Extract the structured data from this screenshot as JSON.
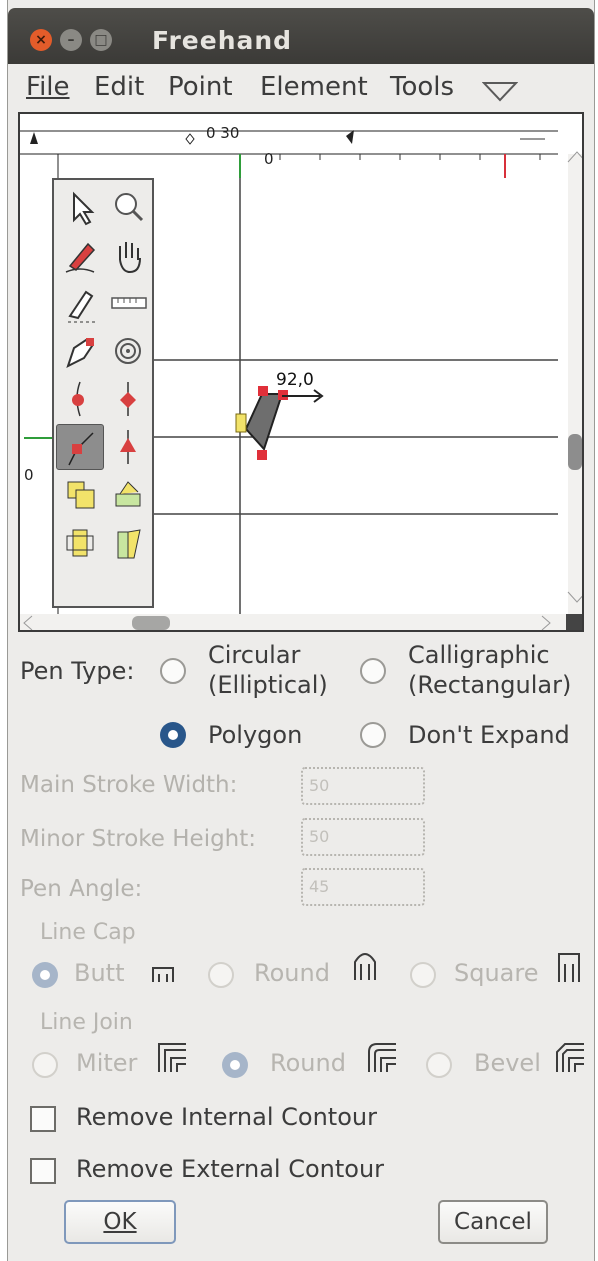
{
  "window": {
    "title": "Freehand"
  },
  "titlebar_buttons": {
    "close": "×",
    "minimize": "–",
    "maximize": "□"
  },
  "menu": [
    {
      "label": "File"
    },
    {
      "label": "Edit"
    },
    {
      "label": "Point"
    },
    {
      "label": "Element"
    },
    {
      "label": "Tools"
    }
  ],
  "menu_overflow_icon": "triangle-down-icon",
  "ruler": {
    "top_label": "0 30",
    "h_zero": "0",
    "v_zero": "0"
  },
  "canvas": {
    "point_label": "92,0"
  },
  "tools": [
    {
      "icon": "pointer-icon"
    },
    {
      "icon": "magnify-icon"
    },
    {
      "icon": "pencil-icon"
    },
    {
      "icon": "hand-icon"
    },
    {
      "icon": "knife-icon"
    },
    {
      "icon": "ruler-icon"
    },
    {
      "icon": "pen-icon"
    },
    {
      "icon": "spiral-icon"
    },
    {
      "icon": "curve-point-icon"
    },
    {
      "icon": "hv-curve-point-icon"
    },
    {
      "icon": "corner-point-icon",
      "selected": true
    },
    {
      "icon": "tangent-point-icon"
    },
    {
      "icon": "scale-icon"
    },
    {
      "icon": "rotate-icon"
    },
    {
      "icon": "flip-icon"
    },
    {
      "icon": "skew-icon"
    }
  ],
  "pen_type": {
    "label": "Pen Type:",
    "circular": "Circular\n(Elliptical)",
    "calligraphic": "Calligraphic\n(Rectangular)",
    "polygon": "Polygon",
    "dont_expand": "Don't Expand",
    "selected": "polygon"
  },
  "fields": {
    "main_stroke_width": {
      "label": "Main Stroke Width:",
      "value": "50"
    },
    "minor_stroke_height": {
      "label": "Minor Stroke Height:",
      "value": "50"
    },
    "pen_angle": {
      "label": "Pen Angle:",
      "value": "45"
    }
  },
  "line_cap": {
    "label": "Line Cap",
    "options": [
      "Butt",
      "Round",
      "Square"
    ],
    "selected": "Butt"
  },
  "line_join": {
    "label": "Line Join",
    "options": [
      "Miter",
      "Round",
      "Bevel"
    ],
    "selected": "Round"
  },
  "checkboxes": {
    "remove_internal": {
      "label": "Remove Internal Contour",
      "checked": false
    },
    "remove_external": {
      "label": "Remove External Contour",
      "checked": false
    }
  },
  "buttons": {
    "ok": "OK",
    "cancel": "Cancel"
  },
  "colors": {
    "titlebar": "#3f3e3a",
    "close": "#e35c2a",
    "accent": "#29568a",
    "point": "#e0303a",
    "shape": "#6e6e6e"
  }
}
